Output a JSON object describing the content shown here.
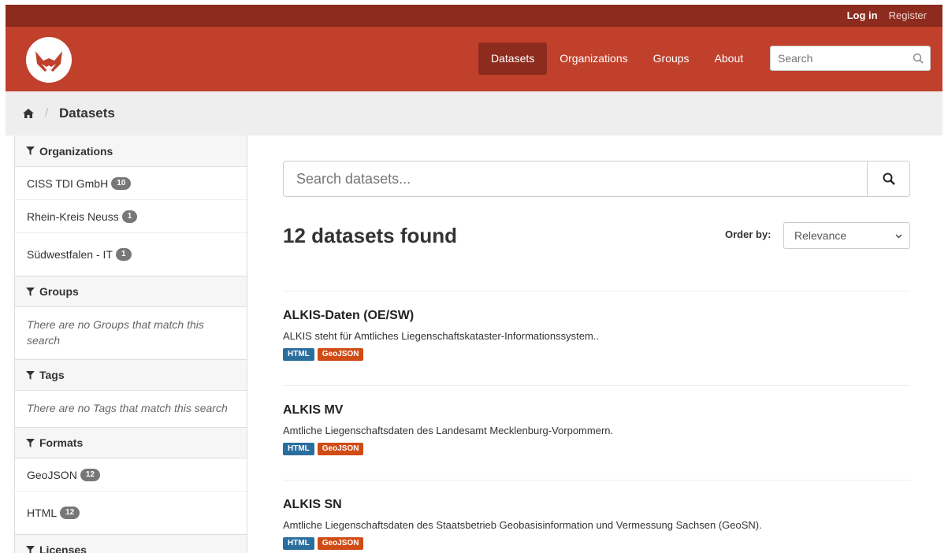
{
  "topbar": {
    "login": "Log in",
    "register": "Register"
  },
  "nav": {
    "items": [
      {
        "label": "Datasets",
        "active": true
      },
      {
        "label": "Organizations"
      },
      {
        "label": "Groups"
      },
      {
        "label": "About"
      }
    ],
    "search_placeholder": "Search"
  },
  "breadcrumb": {
    "separator": "/",
    "current": "Datasets"
  },
  "sidebar": {
    "organizations": {
      "heading": "Organizations",
      "items": [
        {
          "label": "CISS TDI GmbH",
          "count": "10"
        },
        {
          "label": "Rhein-Kreis Neuss",
          "count": "1"
        },
        {
          "label": "Südwestfalen - IT",
          "count": "1"
        }
      ]
    },
    "groups": {
      "heading": "Groups",
      "empty": "There are no Groups that match this search"
    },
    "tags": {
      "heading": "Tags",
      "empty": "There are no Tags that match this search"
    },
    "formats": {
      "heading": "Formats",
      "items": [
        {
          "label": "GeoJSON",
          "count": "12"
        },
        {
          "label": "HTML",
          "count": "12"
        }
      ]
    },
    "licenses": {
      "heading": "Licenses"
    }
  },
  "main": {
    "search_placeholder": "Search datasets...",
    "found_text": "12 datasets found",
    "order_label": "Order by:",
    "order_value": "Relevance",
    "datasets": [
      {
        "title": "ALKIS-Daten (OE/SW)",
        "description": "ALKIS steht für Amtliches Liegenschaftskataster-Informationssystem..",
        "formats": [
          "HTML",
          "GeoJSON"
        ]
      },
      {
        "title": "ALKIS MV",
        "description": "Amtliche Liegenschaftsdaten des Landesamt Mecklenburg-Vorpommern.",
        "formats": [
          "HTML",
          "GeoJSON"
        ]
      },
      {
        "title": "ALKIS SN",
        "description": "Amtliche Liegenschaftsdaten des Staatsbetrieb Geobasisinformation und Vermessung Sachsen (GeoSN).",
        "formats": [
          "HTML",
          "GeoJSON"
        ]
      }
    ]
  },
  "colors": {
    "brand": "#c1402c",
    "brand_dark": "#8c2b1e",
    "tag_html": "#2a6e9e",
    "tag_geojson": "#d14b15"
  },
  "icons": [
    "fox-logo-icon",
    "search-icon",
    "home-icon",
    "funnel-icon",
    "chevron-down-icon"
  ]
}
